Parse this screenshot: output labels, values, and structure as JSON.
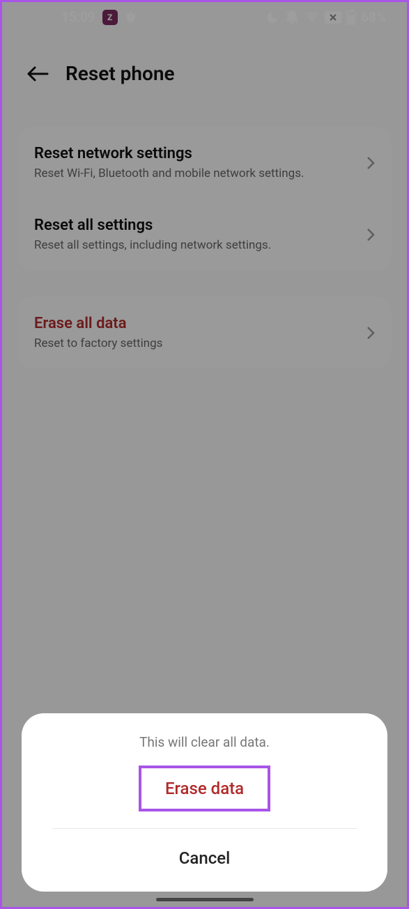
{
  "status": {
    "time": "15:09",
    "battery": "68%"
  },
  "header": {
    "title": "Reset phone"
  },
  "items": {
    "network": {
      "title": "Reset network settings",
      "subtitle": "Reset Wi-Fi, Bluetooth and mobile network settings."
    },
    "all": {
      "title": "Reset all settings",
      "subtitle": "Reset all settings, including network settings."
    },
    "erase": {
      "title": "Erase all data",
      "subtitle": "Reset to factory settings"
    }
  },
  "sheet": {
    "message": "This will clear all data.",
    "erase": "Erase data",
    "cancel": "Cancel"
  }
}
